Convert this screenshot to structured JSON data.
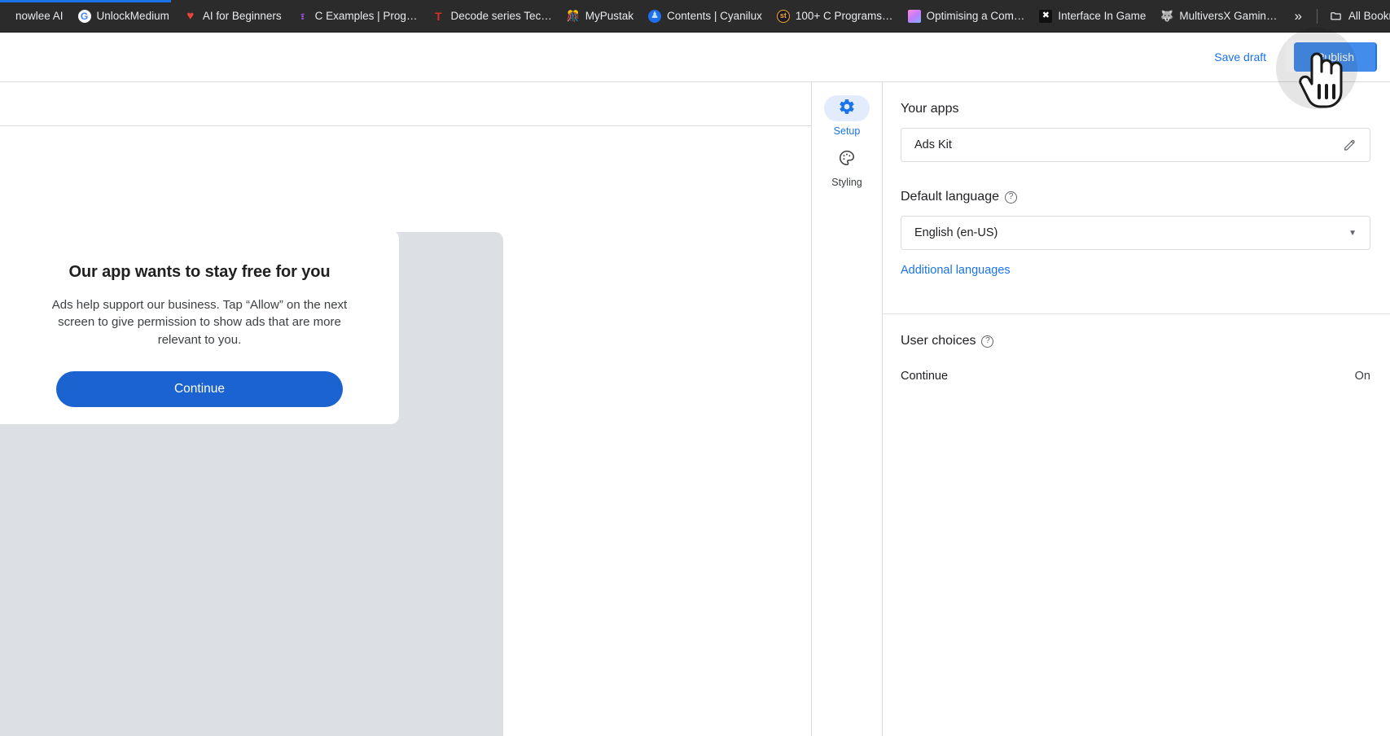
{
  "browser": {
    "bookmarks": [
      {
        "label": "nowlee AI",
        "icon": "",
        "icon_class": ""
      },
      {
        "label": "UnlockMedium",
        "icon": "G",
        "icon_class": "ico-google"
      },
      {
        "label": "AI for Beginners",
        "icon": "♥",
        "icon_class": "ico-heart"
      },
      {
        "label": "C Examples | Prog…",
        "icon": "፣",
        "icon_class": "ico-purple"
      },
      {
        "label": "Decode series Tec…",
        "icon": "T",
        "icon_class": "ico-tee"
      },
      {
        "label": "MyPustak",
        "icon": "🎊",
        "icon_class": "ico-confetti"
      },
      {
        "label": "Contents | Cyanilux",
        "icon": "♟",
        "icon_class": "ico-person"
      },
      {
        "label": "100+ C Programs…",
        "icon": "st",
        "icon_class": "ico-st"
      },
      {
        "label": "Optimising a Com…",
        "icon": "",
        "icon_class": "ico-grad"
      },
      {
        "label": "Interface In Game",
        "icon": "✖",
        "icon_class": "ico-game"
      },
      {
        "label": "MultiversX Gamin…",
        "icon": "🐺",
        "icon_class": "ico-cat"
      }
    ],
    "overflow_label": "»",
    "all_bookmarks_label": "All Bookmarks",
    "folder_icon": "folder-icon"
  },
  "header": {
    "save_draft_label": "Save draft",
    "publish_label": "Publish",
    "accent_color": "#1a73e8"
  },
  "preview": {
    "consent": {
      "title": "Our app wants to stay free for you",
      "body": "Ads help support our business. Tap “Allow” on the next screen to give permission to show ads that are more relevant to you.",
      "button_label": "Continue",
      "button_color": "#1a63d0"
    }
  },
  "nav_rail": {
    "items": [
      {
        "label": "Setup",
        "icon": "gear-icon",
        "active": true
      },
      {
        "label": "Styling",
        "icon": "palette-icon",
        "active": false
      }
    ]
  },
  "settings": {
    "your_apps": {
      "title": "Your apps",
      "app_name": "Ads Kit",
      "edit_icon": "pencil-icon"
    },
    "default_language": {
      "title": "Default language",
      "help_glyph": "?",
      "selected": "English (en-US)",
      "additional_link": "Additional languages"
    },
    "user_choices": {
      "title": "User choices",
      "help_glyph": "?",
      "rows": [
        {
          "label": "Continue",
          "state": "On"
        }
      ]
    }
  }
}
